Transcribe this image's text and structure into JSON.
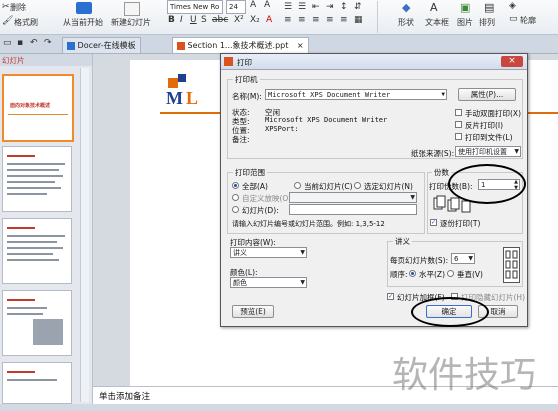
{
  "ribbon": {
    "delete_label": "删除",
    "format_painter_label": "格式刷",
    "from_start_label": "从当前开始",
    "new_slide_label": "新建幻灯片",
    "font_name": "Times New Ro",
    "font_size": "24",
    "shape_label": "形状",
    "textbox_label": "文本框",
    "picture_label": "图片",
    "arrange_label": "排列",
    "outline_label": "轮廓"
  },
  "tabs": {
    "left_label": "幻灯片",
    "docer_label": "Docer-在线模板",
    "file_label": "Section 1...象技术概述.ppt"
  },
  "slide": {
    "thumb1_text": "面向对象技术概述"
  },
  "notes": {
    "placeholder": "单击添加备注"
  },
  "dialog": {
    "title": "打印",
    "printer_group": "打印机",
    "name_label": "名称(M):",
    "printer_name": "Microsoft XPS Document Writer",
    "properties_button": "属性(P)...",
    "status_label": "状态:",
    "status_value": "空闲",
    "type_label": "类型:",
    "type_value": "Microsoft XPS Document Writer",
    "location_label": "位置:",
    "location_value": "XPSPort:",
    "comment_label": "备注:",
    "manual_duplex": "手动双面打印(X)",
    "reverse_print": "反片打印(I)",
    "print_to_file": "打印到文件(L)",
    "paper_source_label": "纸张来源(S):",
    "paper_source_value": "使用打印机设置",
    "range_group": "打印范围",
    "range_all": "全部(A)",
    "range_current": "当前幻灯片(C)",
    "range_selection": "选定幻灯片(N)",
    "range_custom": "自定义放映(O):",
    "range_slides": "幻灯片(D):",
    "range_hint": "请输入幻灯片编号或幻灯片范围。例如: 1,3,5-12",
    "copies_group": "份数",
    "copies_label": "打印份数(B):",
    "copies_value": "1",
    "collate_label": "逐份打印(T)",
    "print_content_label": "打印内容(W):",
    "print_content_value": "讲义",
    "handout_group": "讲义",
    "per_page_label": "每页幻灯片数(S):",
    "per_page_value": "6",
    "order_label": "顺序:",
    "order_horizontal": "水平(Z)",
    "order_vertical": "垂直(V)",
    "color_label": "颜色(L):",
    "color_value": "颜色",
    "frame_slides": "幻灯片加框(F)",
    "print_hidden": "打印隐藏幻灯片(H)",
    "preview_button": "预览(E)",
    "ok_button": "确定",
    "cancel_button": "取消"
  },
  "watermark": {
    "text": "软件技巧"
  },
  "colors": {
    "accent_orange": "#e36c0a",
    "logo_blue": "#1f3f8f",
    "dialog_title_icon": "#d9531e"
  }
}
